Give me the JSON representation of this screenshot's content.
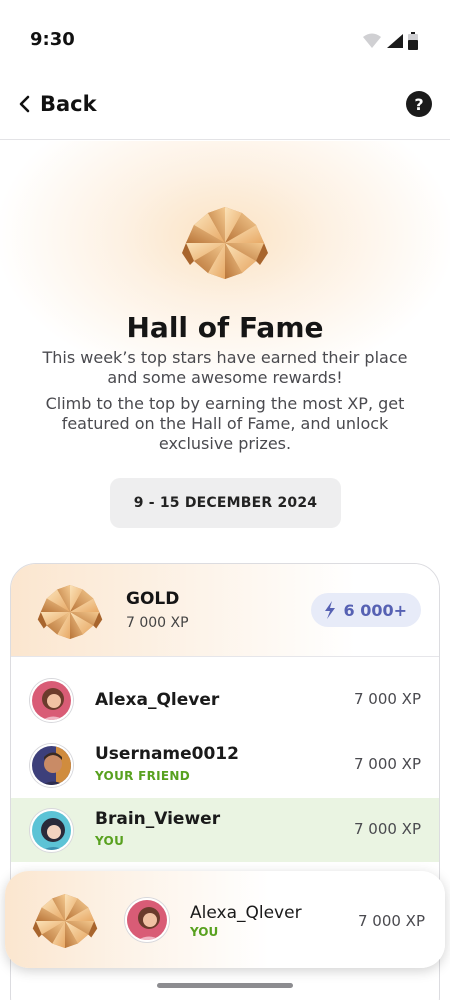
{
  "status_bar": {
    "time": "9:30"
  },
  "header": {
    "back_label": "Back",
    "help_label": "?"
  },
  "hero": {
    "title": "Hall of Fame",
    "text_1": "This week’s top stars have earned their place and some awesome rewards!",
    "text_2": "Climb to the top by earning the most XP, get featured on the Hall of Fame, and unlock exclusive prizes.",
    "date_range": "9 - 15 DECEMBER 2024"
  },
  "league": {
    "name": "GOLD",
    "xp": "7 000 XP",
    "reward": "6 000+",
    "rows": [
      {
        "name": "Alexa_Qlever",
        "sub": "",
        "xp": "7 000 XP"
      },
      {
        "name": "Username0012",
        "sub": "YOUR FRIEND",
        "xp": "7 000 XP"
      },
      {
        "name": "Brain_Viewer",
        "sub": "YOU",
        "xp": "7 000 XP"
      }
    ]
  },
  "current_user": {
    "name": "Alexa_Qlever",
    "sub": "YOU",
    "xp": "7 000 XP"
  },
  "colors": {
    "accent_green": "#58a11f",
    "highlight_row": "#eaf4e2",
    "reward_text": "#5661b3",
    "gold": "#e0a464"
  },
  "icons": [
    "wifi-icon",
    "signal-icon",
    "battery-icon",
    "back-chevron-icon",
    "help-icon",
    "gold-badge-icon",
    "lightning-icon"
  ]
}
